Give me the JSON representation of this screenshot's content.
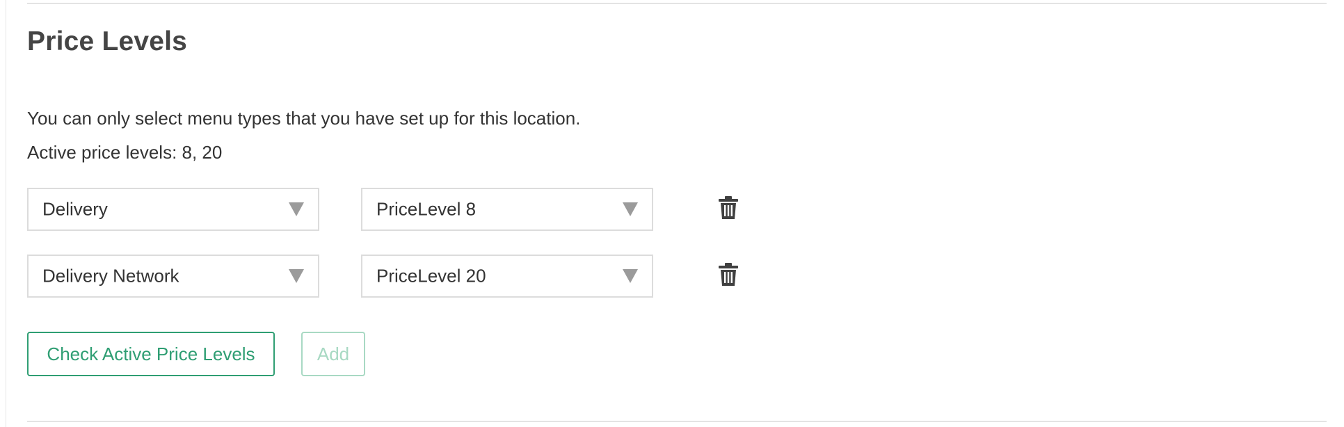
{
  "section": {
    "title": "Price Levels",
    "help_text": "You can only select menu types that you have set up for this location.",
    "active_levels_text": "Active price levels: 8, 20"
  },
  "rows": [
    {
      "menu_type": "Delivery",
      "price_level": "PriceLevel 8",
      "delete_icon": "trash-icon"
    },
    {
      "menu_type": "Delivery Network",
      "price_level": "PriceLevel 20",
      "delete_icon": "trash-icon"
    }
  ],
  "actions": {
    "check_label": "Check Active Price Levels",
    "add_label": "Add",
    "add_disabled": true
  },
  "colors": {
    "accent": "#2f9e73",
    "accent_disabled": "#a8d9c3",
    "caret": "#9b9b9b",
    "icon": "#404040",
    "border": "#dcdcdc"
  }
}
